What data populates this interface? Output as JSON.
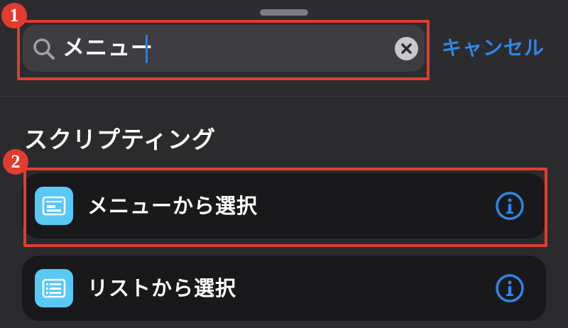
{
  "search": {
    "query": "メニュー",
    "cancel_label": "キャンセル"
  },
  "annotations": {
    "marker_1": "❶",
    "marker_2": "❷",
    "color": "#e23c2f"
  },
  "section": {
    "title": "スクリプティング"
  },
  "results": [
    {
      "label": "メニューから選択",
      "icon": "menu-list-icon"
    },
    {
      "label": "リストから選択",
      "icon": "list-icon"
    }
  ],
  "colors": {
    "accent": "#2f86e8",
    "action_icon_bg": "#5ac8f5"
  }
}
